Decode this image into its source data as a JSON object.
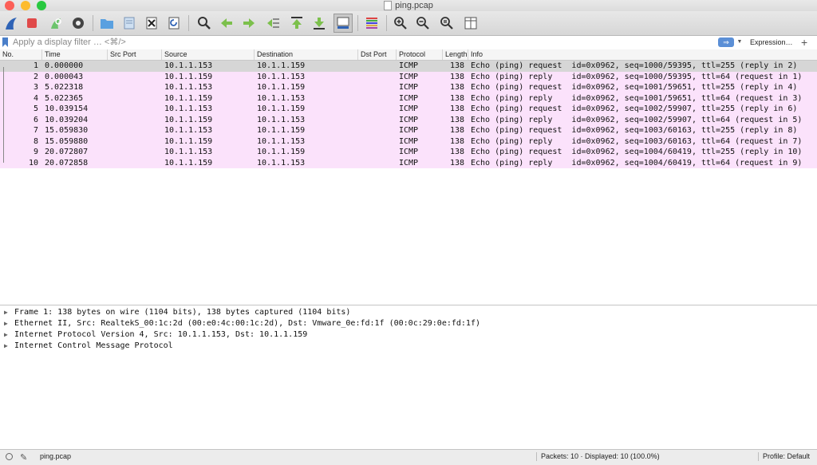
{
  "window": {
    "title": "ping.pcap"
  },
  "toolbar": {
    "icons": [
      "shark-fin-start-icon",
      "stop-capture-icon",
      "restart-capture-icon",
      "capture-options-icon",
      "open-folder-icon",
      "file-set-icon",
      "close-file-icon",
      "reload-icon",
      "find-icon",
      "go-back-icon",
      "go-forward-icon",
      "go-to-packet-icon",
      "first-packet-icon",
      "last-packet-icon",
      "autoscroll-icon",
      "colorize-icon",
      "zoom-in-icon",
      "zoom-out-icon",
      "normal-size-icon",
      "resize-columns-icon"
    ]
  },
  "filter": {
    "placeholder": "Apply a display filter … <⌘/>",
    "value": "",
    "apply_label": "⇒",
    "expression_label": "Expression…",
    "add_label": "+"
  },
  "columns": [
    "No.",
    "Time",
    "Src Port",
    "Source",
    "Destination",
    "Dst Port",
    "Protocol",
    "Length",
    "Info"
  ],
  "packets": [
    {
      "no": "1",
      "time": "0.000000",
      "source": "10.1.1.153",
      "destination": "10.1.1.159",
      "protocol": "ICMP",
      "length": "138",
      "info": "Echo (ping) request  id=0x0962, seq=1000/59395, ttl=255 (reply in 2)"
    },
    {
      "no": "2",
      "time": "0.000043",
      "source": "10.1.1.159",
      "destination": "10.1.1.153",
      "protocol": "ICMP",
      "length": "138",
      "info": "Echo (ping) reply    id=0x0962, seq=1000/59395, ttl=64 (request in 1)"
    },
    {
      "no": "3",
      "time": "5.022318",
      "source": "10.1.1.153",
      "destination": "10.1.1.159",
      "protocol": "ICMP",
      "length": "138",
      "info": "Echo (ping) request  id=0x0962, seq=1001/59651, ttl=255 (reply in 4)"
    },
    {
      "no": "4",
      "time": "5.022365",
      "source": "10.1.1.159",
      "destination": "10.1.1.153",
      "protocol": "ICMP",
      "length": "138",
      "info": "Echo (ping) reply    id=0x0962, seq=1001/59651, ttl=64 (request in 3)"
    },
    {
      "no": "5",
      "time": "10.039154",
      "source": "10.1.1.153",
      "destination": "10.1.1.159",
      "protocol": "ICMP",
      "length": "138",
      "info": "Echo (ping) request  id=0x0962, seq=1002/59907, ttl=255 (reply in 6)"
    },
    {
      "no": "6",
      "time": "10.039204",
      "source": "10.1.1.159",
      "destination": "10.1.1.153",
      "protocol": "ICMP",
      "length": "138",
      "info": "Echo (ping) reply    id=0x0962, seq=1002/59907, ttl=64 (request in 5)"
    },
    {
      "no": "7",
      "time": "15.059830",
      "source": "10.1.1.153",
      "destination": "10.1.1.159",
      "protocol": "ICMP",
      "length": "138",
      "info": "Echo (ping) request  id=0x0962, seq=1003/60163, ttl=255 (reply in 8)"
    },
    {
      "no": "8",
      "time": "15.059880",
      "source": "10.1.1.159",
      "destination": "10.1.1.153",
      "protocol": "ICMP",
      "length": "138",
      "info": "Echo (ping) reply    id=0x0962, seq=1003/60163, ttl=64 (request in 7)"
    },
    {
      "no": "9",
      "time": "20.072807",
      "source": "10.1.1.153",
      "destination": "10.1.1.159",
      "protocol": "ICMP",
      "length": "138",
      "info": "Echo (ping) request  id=0x0962, seq=1004/60419, ttl=255 (reply in 10)"
    },
    {
      "no": "10",
      "time": "20.072858",
      "source": "10.1.1.159",
      "destination": "10.1.1.153",
      "protocol": "ICMP",
      "length": "138",
      "info": "Echo (ping) reply    id=0x0962, seq=1004/60419, ttl=64 (request in 9)"
    }
  ],
  "selected_packet": "1",
  "details": [
    "Frame 1: 138 bytes on wire (1104 bits), 138 bytes captured (1104 bits)",
    "Ethernet II, Src: RealtekS_00:1c:2d (00:e0:4c:00:1c:2d), Dst: Vmware_0e:fd:1f (00:0c:29:0e:fd:1f)",
    "Internet Protocol Version 4, Src: 10.1.1.153, Dst: 10.1.1.159",
    "Internet Control Message Protocol"
  ],
  "status": {
    "file": "ping.pcap",
    "packets": "Packets: 10 · Displayed: 10 (100.0%)",
    "profile": "Profile: Default"
  },
  "colors": {
    "icmp_row": "#fbe2fb",
    "selected_row": "#d6d6d6",
    "accent": "#5b8fd6"
  }
}
